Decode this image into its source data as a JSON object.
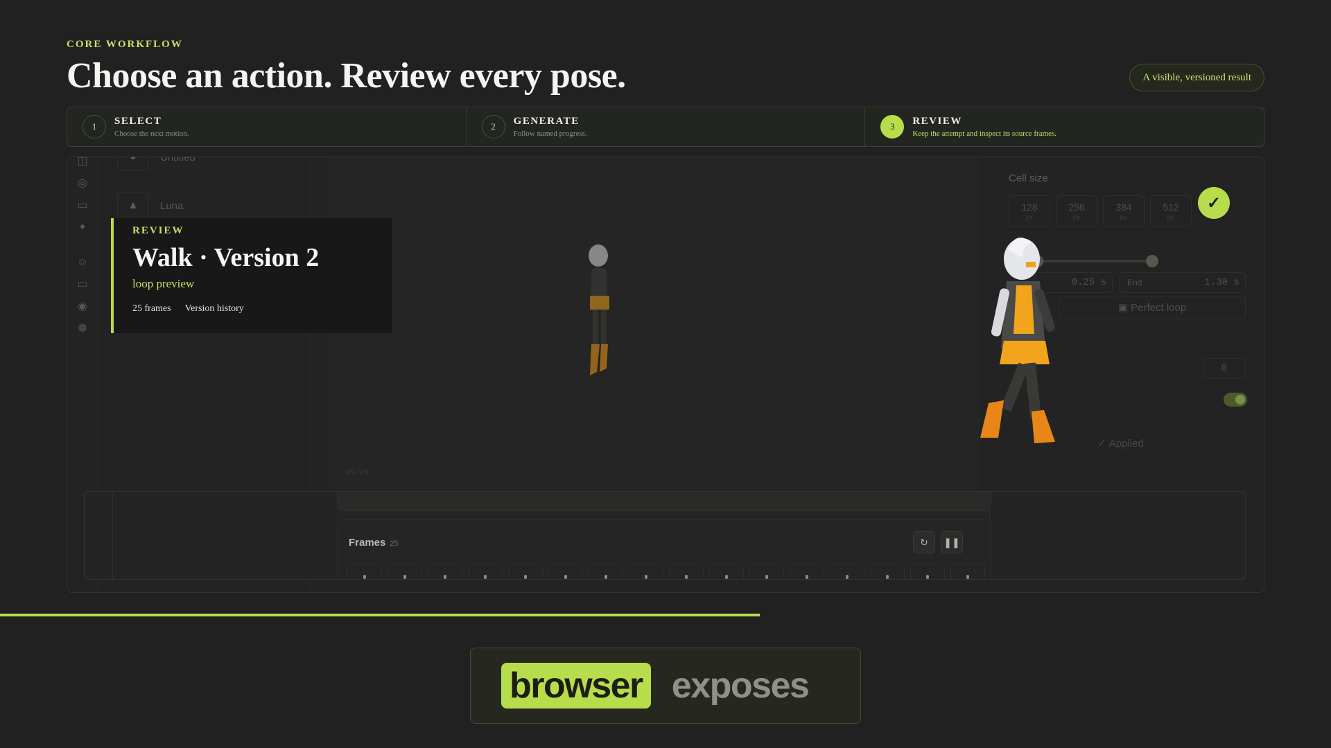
{
  "header": {
    "eyebrow": "CORE WORKFLOW",
    "title": "Choose an action. Review every pose.",
    "badge": "A visible, versioned result"
  },
  "steps": [
    {
      "num": "1",
      "title": "SELECT",
      "subtitle": "Choose the next motion."
    },
    {
      "num": "2",
      "title": "GENERATE",
      "subtitle": "Follow named progress."
    },
    {
      "num": "3",
      "title": "REVIEW",
      "subtitle": "Keep the attempt and inspect its source frames."
    }
  ],
  "sidebar": {
    "characters": [
      {
        "name": "Untitled"
      },
      {
        "name": "Luna"
      }
    ]
  },
  "stage": {
    "counter": "05/25"
  },
  "settings": {
    "cell_size_label": "Cell size",
    "cell_sizes": [
      {
        "value": "128",
        "unit": "px"
      },
      {
        "value": "256",
        "unit": "px"
      },
      {
        "value": "384",
        "unit": "px"
      },
      {
        "value": "512",
        "unit": "px"
      }
    ],
    "start_value": "0.25",
    "start_unit": "s",
    "end_label": "End",
    "end_value": "1.30",
    "end_unit": "s",
    "perfect_loop_label": "Perfect loop",
    "offset_value": "0",
    "applied_label": "Applied"
  },
  "review_card": {
    "label": "REVIEW",
    "title": "Walk · Version 2",
    "subtitle": "loop preview",
    "frames": "25 frames",
    "history": "Version history"
  },
  "frames_panel": {
    "title": "Frames",
    "count": "25"
  },
  "progress": {
    "fraction": 0.571
  },
  "caption": {
    "highlight": "browser",
    "rest": "exposes"
  },
  "colors": {
    "accent": "#b8dd4c",
    "background": "#202120"
  }
}
